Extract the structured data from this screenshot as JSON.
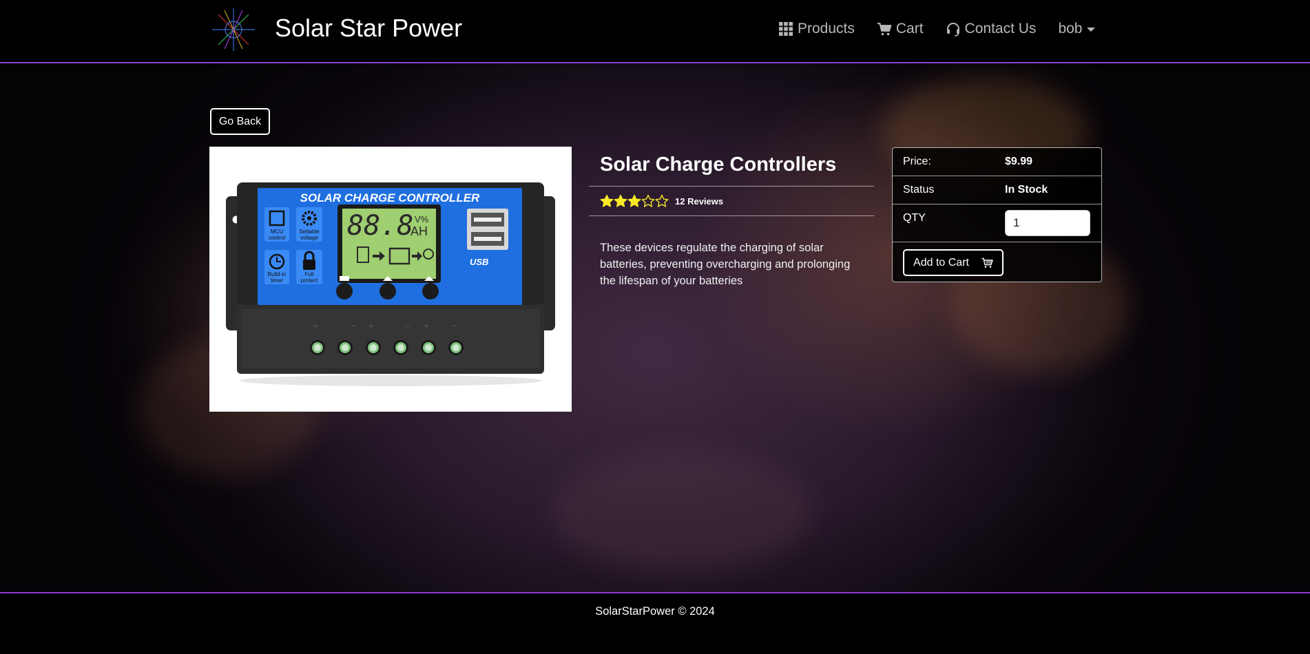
{
  "header": {
    "brand": "Solar Star Power",
    "nav": {
      "products": "Products",
      "cart": "Cart",
      "contact": "Contact Us",
      "user": "bob"
    }
  },
  "main": {
    "back_label": "Go Back",
    "product": {
      "title": "Solar Charge Controllers",
      "rating": 3,
      "rating_max": 5,
      "reviews": "12 Reviews",
      "description": "These devices regulate the charging of solar batteries, preventing overcharging and prolonging the lifespan of your batteries",
      "image": {
        "banner": "SOLAR CHARGE CONTROLLER",
        "lcd_digits": "88.8",
        "lcd_unit_top": "V%",
        "lcd_unit_bottom": "AH",
        "mcu_label_1": "MCU",
        "mcu_label_2": "control",
        "settable_label_1": "Settable",
        "settable_label_2": "voltage",
        "timer_label_1": "Build-in",
        "timer_label_2": "timer",
        "protect_label_1": "Full",
        "protect_label_2": "protect",
        "usb_label": "USB"
      }
    },
    "buy": {
      "price_label": "Price:",
      "price_value": "$9.99",
      "status_label": "Status",
      "status_value": "In Stock",
      "qty_label": "QTY",
      "qty_value": "1",
      "add_label": "Add to Cart"
    }
  },
  "footer": {
    "text": "SolarStarPower © 2024"
  },
  "colors": {
    "accent": "#8a3fd6",
    "star": "#f8e825",
    "controller_blue": "#1f6fe0"
  }
}
